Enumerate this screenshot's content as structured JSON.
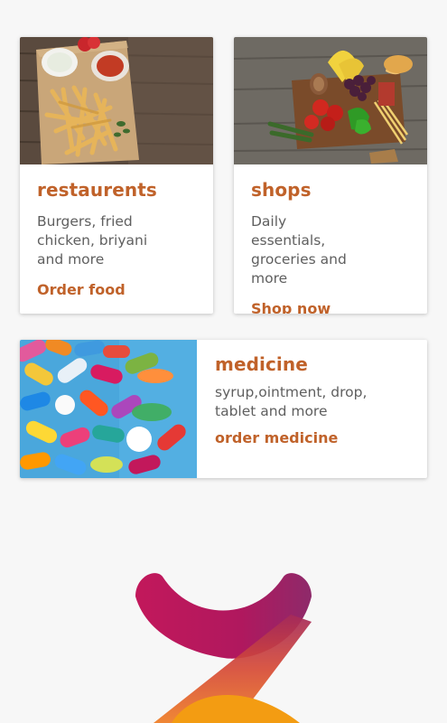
{
  "cards": {
    "restaurants": {
      "title": "restaurents",
      "description": "Burgers, fried chicken, briyani and more",
      "action": "Order food"
    },
    "shops": {
      "title": "shops",
      "description": "Daily essentials, groceries and more",
      "action": "Shop now"
    },
    "medicine": {
      "title": "medicine",
      "description": "syrup,ointment, drop, tablet and more",
      "action": "order medicine"
    }
  },
  "colors": {
    "accent": "#c0622a",
    "text_muted": "#5f5f5f",
    "background": "#f7f7f7",
    "logo_magenta": "#c2185b",
    "logo_orange": "#f39c12"
  },
  "icons": [
    "restaurants-image",
    "shops-image",
    "medicine-image",
    "brand-logo"
  ]
}
